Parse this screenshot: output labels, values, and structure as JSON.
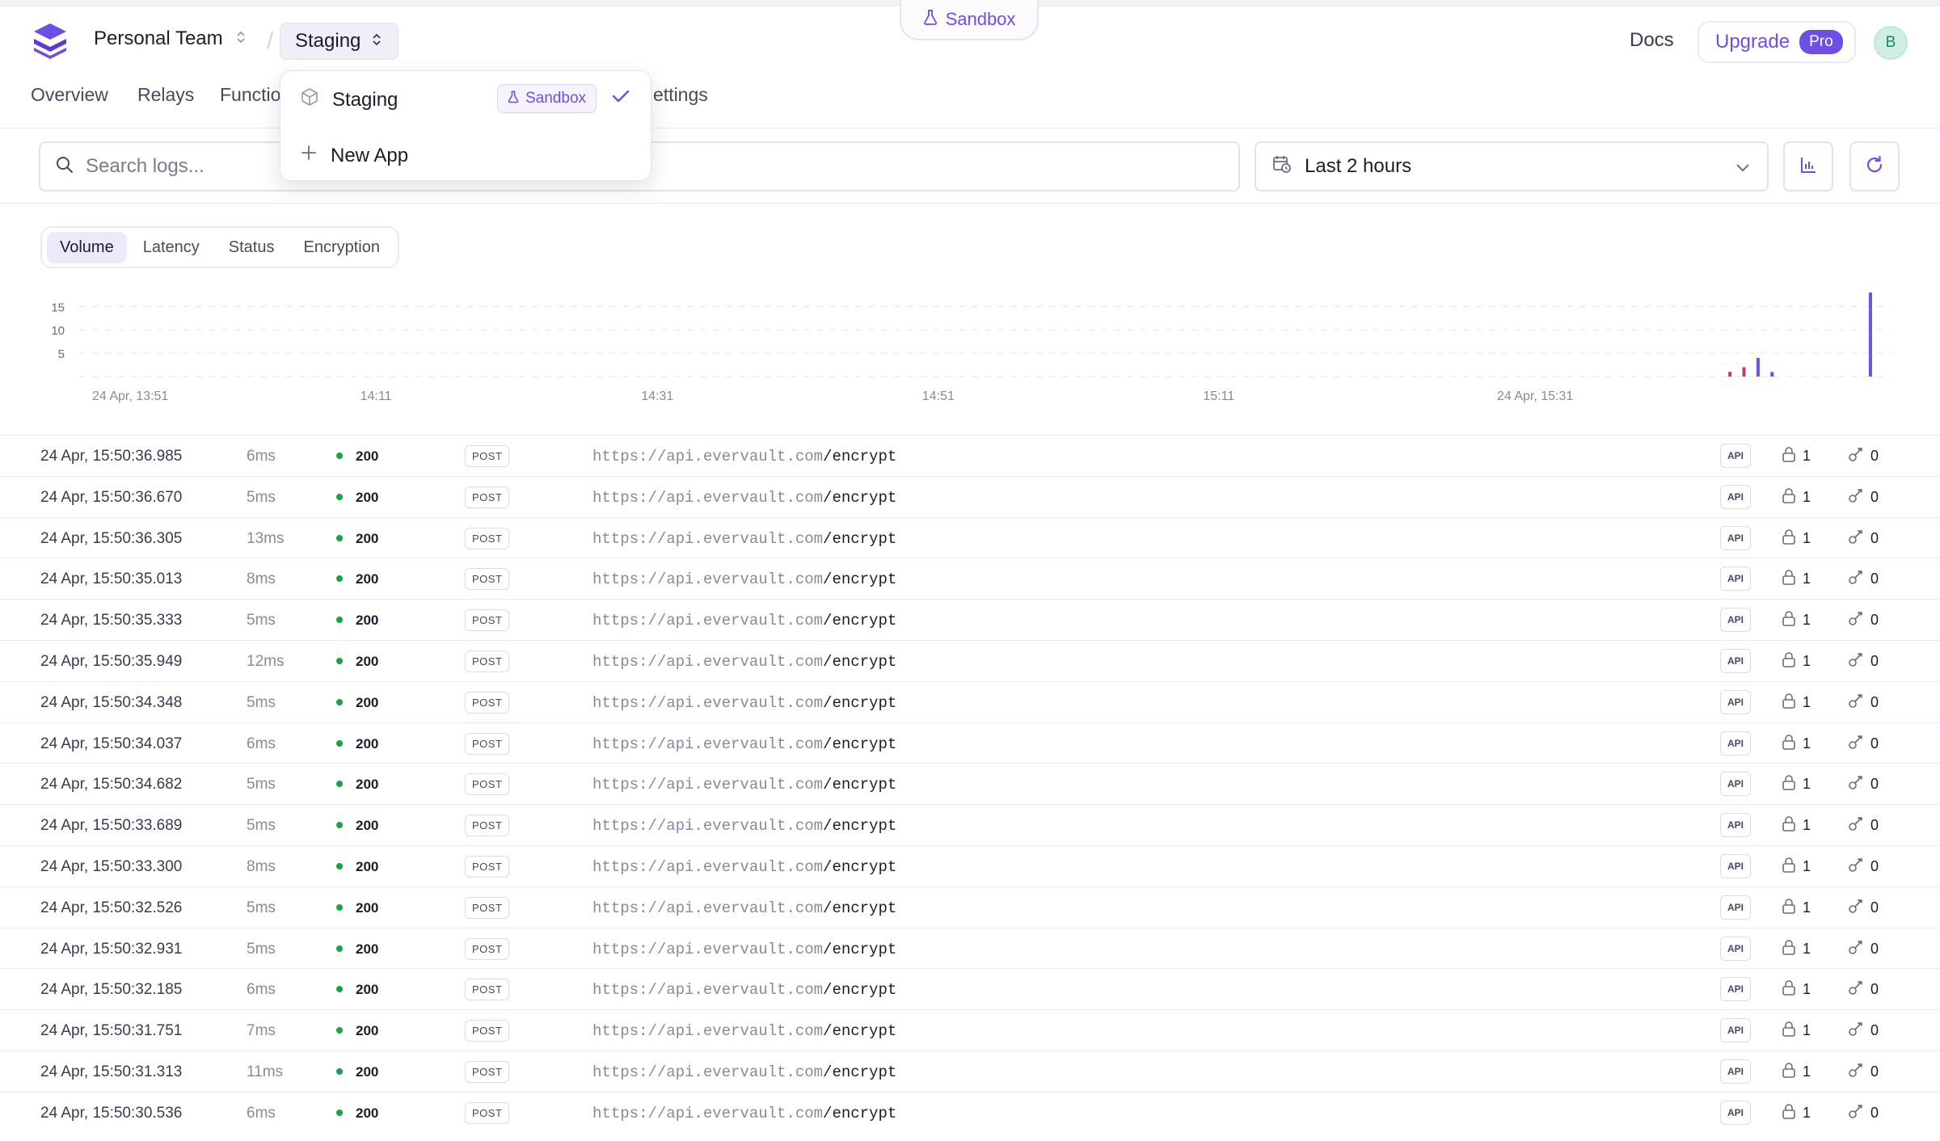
{
  "environment_tab": {
    "label": "Sandbox",
    "icon": "flask-icon"
  },
  "header": {
    "team_name": "Personal Team",
    "app_name": "Staging",
    "docs_label": "Docs",
    "upgrade_label": "Upgrade",
    "pro_badge": "Pro",
    "avatar_initial": "B"
  },
  "nav": {
    "items": [
      {
        "label": "Overview"
      },
      {
        "label": "Relays"
      },
      {
        "label": "Functio"
      },
      {
        "label": "ettings"
      }
    ]
  },
  "app_dropdown": {
    "current_app": "Staging",
    "current_app_badge": "Sandbox",
    "new_app_label": "New App"
  },
  "toolbar": {
    "search_placeholder": "Search logs...",
    "time_range": "Last 2 hours"
  },
  "chart_tabs": {
    "items": [
      "Volume",
      "Latency",
      "Status",
      "Encryption"
    ],
    "active": "Volume"
  },
  "chart_data": {
    "type": "bar",
    "title": "",
    "xlabel": "",
    "ylabel": "",
    "y_ticks": [
      "15",
      "10",
      "5"
    ],
    "x_ticks": [
      "24 Apr, 13:51",
      "14:11",
      "14:31",
      "14:51",
      "15:11",
      "24 Apr, 15:31"
    ],
    "ylim": [
      0,
      18
    ],
    "grid": true,
    "colors": {
      "pink": "#d1346b",
      "purple": "#6d4ee6",
      "grid": "#e5e4ec"
    },
    "series": [
      {
        "values": [
          {
            "x_minutes": 117.5,
            "y": 1,
            "color": "pink"
          },
          {
            "x_minutes": 118.5,
            "y": 2,
            "color": "pink"
          },
          {
            "x_minutes": 119.5,
            "y": 4,
            "color": "purple"
          },
          {
            "x_minutes": 120.5,
            "y": 1,
            "color": "purple"
          },
          {
            "x_minutes": 127.5,
            "y": 18,
            "color": "purple"
          }
        ]
      }
    ]
  },
  "logs": {
    "url_host": "https://api.evervault.com",
    "url_path": "/encrypt",
    "rows": [
      {
        "time": "24 Apr, 15:50:36.985",
        "latency": "6ms",
        "status": "200",
        "method": "POST",
        "source": "API",
        "encrypted": "1",
        "decrypted": "0"
      },
      {
        "time": "24 Apr, 15:50:36.670",
        "latency": "5ms",
        "status": "200",
        "method": "POST",
        "source": "API",
        "encrypted": "1",
        "decrypted": "0"
      },
      {
        "time": "24 Apr, 15:50:36.305",
        "latency": "13ms",
        "status": "200",
        "method": "POST",
        "source": "API",
        "encrypted": "1",
        "decrypted": "0"
      },
      {
        "time": "24 Apr, 15:50:35.013",
        "latency": "8ms",
        "status": "200",
        "method": "POST",
        "source": "API",
        "encrypted": "1",
        "decrypted": "0"
      },
      {
        "time": "24 Apr, 15:50:35.333",
        "latency": "5ms",
        "status": "200",
        "method": "POST",
        "source": "API",
        "encrypted": "1",
        "decrypted": "0"
      },
      {
        "time": "24 Apr, 15:50:35.949",
        "latency": "12ms",
        "status": "200",
        "method": "POST",
        "source": "API",
        "encrypted": "1",
        "decrypted": "0"
      },
      {
        "time": "24 Apr, 15:50:34.348",
        "latency": "5ms",
        "status": "200",
        "method": "POST",
        "source": "API",
        "encrypted": "1",
        "decrypted": "0"
      },
      {
        "time": "24 Apr, 15:50:34.037",
        "latency": "6ms",
        "status": "200",
        "method": "POST",
        "source": "API",
        "encrypted": "1",
        "decrypted": "0"
      },
      {
        "time": "24 Apr, 15:50:34.682",
        "latency": "5ms",
        "status": "200",
        "method": "POST",
        "source": "API",
        "encrypted": "1",
        "decrypted": "0"
      },
      {
        "time": "24 Apr, 15:50:33.689",
        "latency": "5ms",
        "status": "200",
        "method": "POST",
        "source": "API",
        "encrypted": "1",
        "decrypted": "0"
      },
      {
        "time": "24 Apr, 15:50:33.300",
        "latency": "8ms",
        "status": "200",
        "method": "POST",
        "source": "API",
        "encrypted": "1",
        "decrypted": "0"
      },
      {
        "time": "24 Apr, 15:50:32.526",
        "latency": "5ms",
        "status": "200",
        "method": "POST",
        "source": "API",
        "encrypted": "1",
        "decrypted": "0"
      },
      {
        "time": "24 Apr, 15:50:32.931",
        "latency": "5ms",
        "status": "200",
        "method": "POST",
        "source": "API",
        "encrypted": "1",
        "decrypted": "0"
      },
      {
        "time": "24 Apr, 15:50:32.185",
        "latency": "6ms",
        "status": "200",
        "method": "POST",
        "source": "API",
        "encrypted": "1",
        "decrypted": "0"
      },
      {
        "time": "24 Apr, 15:50:31.751",
        "latency": "7ms",
        "status": "200",
        "method": "POST",
        "source": "API",
        "encrypted": "1",
        "decrypted": "0"
      },
      {
        "time": "24 Apr, 15:50:31.313",
        "latency": "11ms",
        "status": "200",
        "method": "POST",
        "source": "API",
        "encrypted": "1",
        "decrypted": "0"
      },
      {
        "time": "24 Apr, 15:50:30.536",
        "latency": "6ms",
        "status": "200",
        "method": "POST",
        "source": "API",
        "encrypted": "1",
        "decrypted": "0"
      }
    ]
  }
}
